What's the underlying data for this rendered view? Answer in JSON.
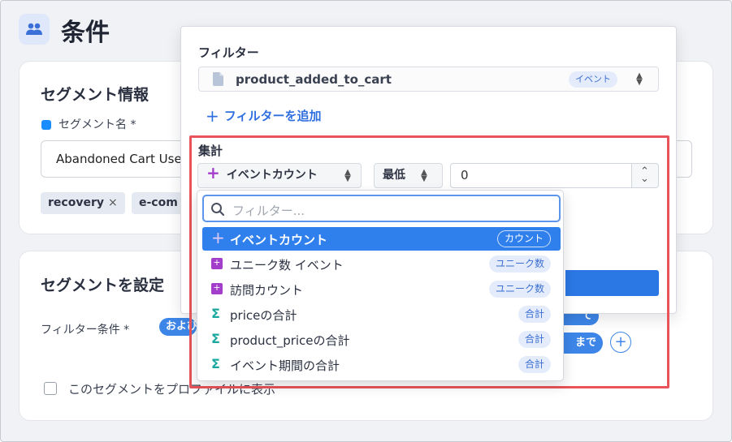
{
  "header": {
    "title": "条件",
    "icon": "users-icon"
  },
  "segment_info": {
    "title": "セグメント情報",
    "name_label": "セグメント名 *",
    "name_value": "Abandoned Cart Use",
    "tags": [
      {
        "label": "recovery",
        "remove": "×"
      },
      {
        "label": "e-com",
        "remove": ""
      }
    ]
  },
  "segment_config": {
    "title": "セグメントを設定",
    "filter_condition_label": "フィルター条件 *",
    "and_pill": "および",
    "pill_right_1": "て",
    "pill_right_2": "まで",
    "add_button": "+",
    "show_on_profile_label": "このセグメントをプロファイルに表示"
  },
  "filter_popover": {
    "filter_label": "フィルター",
    "event_name": "product_added_to_cart",
    "event_badge": "イベント",
    "add_filter": "フィルターを追加",
    "add_filter_icon": "+",
    "aggregation_label": "集計",
    "aggregation_function": "イベントカウント",
    "aggregation_icon": "+",
    "comparison": "最低",
    "comparison_value": "0",
    "spin_up": "⌃",
    "spin_down": "⌄"
  },
  "dropdown": {
    "search_placeholder": "フィルター...",
    "items": [
      {
        "label": "イベントカウント",
        "badge": "カウント",
        "icon": "plus-icon"
      },
      {
        "label": "ユニーク数 イベント",
        "badge": "ユニーク数",
        "icon": "unique-icon"
      },
      {
        "label": "訪問カウント",
        "badge": "ユニーク数",
        "icon": "unique-icon"
      },
      {
        "label": "priceの合計",
        "badge": "合計",
        "icon": "sigma-icon"
      },
      {
        "label": "product_priceの合計",
        "badge": "合計",
        "icon": "sigma-icon"
      },
      {
        "label": "イベント期間の合計",
        "badge": "合計",
        "icon": "sigma-icon"
      }
    ]
  },
  "colors": {
    "accent": "#2f80ed",
    "highlight": "#e8545a",
    "purple": "#a23ec9",
    "teal": "#1aa7a0"
  }
}
